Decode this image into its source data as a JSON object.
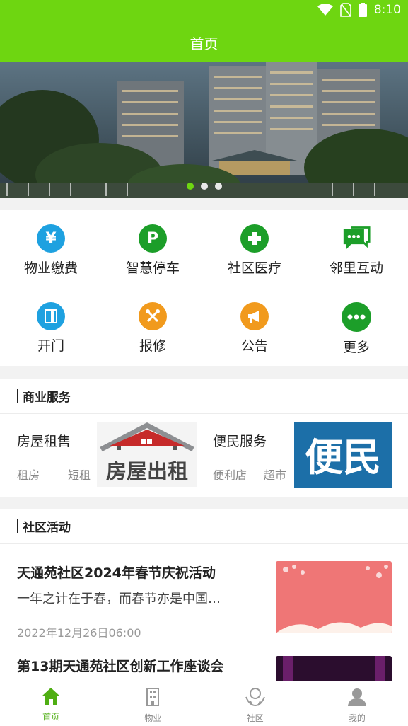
{
  "status": {
    "time": "8:10"
  },
  "header": {
    "title": "首页"
  },
  "banner": {
    "slide_count": 3,
    "active_index": 0
  },
  "services": [
    {
      "label": "物业缴费",
      "icon": "yen-icon",
      "color": "#1ea1e0"
    },
    {
      "label": "智慧停车",
      "icon": "parking-icon",
      "color": "#1c9e29"
    },
    {
      "label": "社区医疗",
      "icon": "medical-cross-icon",
      "color": "#1c9e29"
    },
    {
      "label": "邻里互动",
      "icon": "chat-icon",
      "color": "#1c9e29"
    },
    {
      "label": "开门",
      "icon": "door-icon",
      "color": "#1ea1e0"
    },
    {
      "label": "报修",
      "icon": "repair-icon",
      "color": "#f19a1d"
    },
    {
      "label": "公告",
      "icon": "megaphone-icon",
      "color": "#f19a1d"
    },
    {
      "label": "更多",
      "icon": "more-icon",
      "color": "#1c9e29"
    }
  ],
  "business": {
    "title": "商业服务",
    "rental": {
      "title": "房屋租售",
      "tags": [
        "租房",
        "短租"
      ],
      "image_text": "房屋出租"
    },
    "convenience": {
      "title": "便民服务",
      "tags": [
        "便利店",
        "超市"
      ],
      "image_text": "便民"
    }
  },
  "activities": {
    "title": "社区活动",
    "items": [
      {
        "title": "天通苑社区2024年春节庆祝活动",
        "summary": "一年之计在于春，而春节亦是中国…",
        "date": "2022年12月26日06:00"
      },
      {
        "title": "第13期天通苑社区创新工作座谈会",
        "summary": "",
        "date": ""
      }
    ]
  },
  "tabbar": {
    "tabs": [
      {
        "label": "首页",
        "icon": "home-icon",
        "active": true
      },
      {
        "label": "物业",
        "icon": "building-icon",
        "active": false
      },
      {
        "label": "社区",
        "icon": "community-icon",
        "active": false
      },
      {
        "label": "我的",
        "icon": "user-icon",
        "active": false
      }
    ]
  }
}
